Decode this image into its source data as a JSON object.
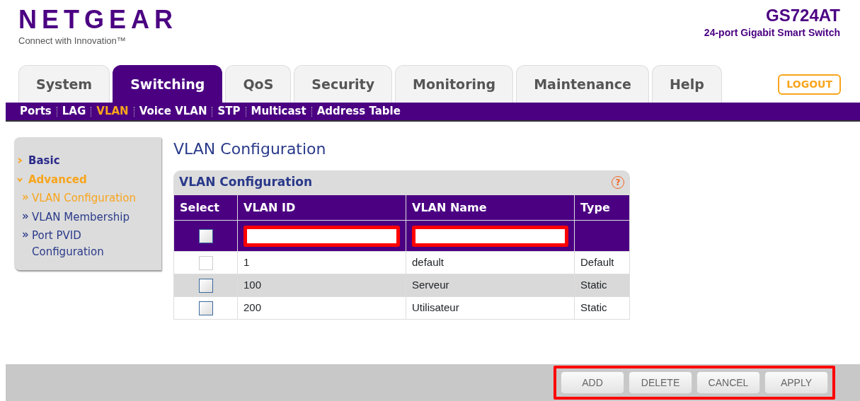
{
  "header": {
    "brand": "NETGEAR",
    "tagline": "Connect with Innovation™",
    "model": "GS724AT",
    "model_description": "24-port Gigabit Smart Switch"
  },
  "tabs": [
    {
      "label": "System",
      "selected": false
    },
    {
      "label": "Switching",
      "selected": true
    },
    {
      "label": "QoS",
      "selected": false
    },
    {
      "label": "Security",
      "selected": false
    },
    {
      "label": "Monitoring",
      "selected": false
    },
    {
      "label": "Maintenance",
      "selected": false
    },
    {
      "label": "Help",
      "selected": false
    }
  ],
  "logout": "LOGOUT",
  "subnav": [
    {
      "label": "Ports",
      "selected": false
    },
    {
      "label": "LAG",
      "selected": false
    },
    {
      "label": "VLAN",
      "selected": true
    },
    {
      "label": "Voice VLAN",
      "selected": false
    },
    {
      "label": "STP",
      "selected": false
    },
    {
      "label": "Multicast",
      "selected": false
    },
    {
      "label": "Address Table",
      "selected": false
    }
  ],
  "sidebar": {
    "items": [
      {
        "label": "Basic",
        "selected": false,
        "expanded": false
      },
      {
        "label": "Advanced",
        "selected": true,
        "expanded": true,
        "children": [
          {
            "label": "VLAN Configuration",
            "selected": true
          },
          {
            "label": "VLAN Membership",
            "selected": false
          },
          {
            "label": "Port PVID Configuration",
            "selected": false
          }
        ]
      }
    ]
  },
  "page_title": "VLAN Configuration",
  "panel": {
    "title": "VLAN Configuration",
    "help": "?",
    "table": {
      "columns": [
        "Select",
        "VLAN ID",
        "VLAN Name",
        "Type"
      ],
      "new_row": {
        "checked": false,
        "highlighted": true
      },
      "rows": [
        {
          "checked": false,
          "disabled": true,
          "vlan_id": "1",
          "vlan_name": "default",
          "type": "Default"
        },
        {
          "checked": false,
          "disabled": false,
          "vlan_id": "100",
          "vlan_name": "Serveur",
          "type": "Static"
        },
        {
          "checked": false,
          "disabled": false,
          "vlan_id": "200",
          "vlan_name": "Utilisateur",
          "type": "Static"
        }
      ]
    }
  },
  "buttons": {
    "highlighted": true,
    "items": [
      "ADD",
      "DELETE",
      "CANCEL",
      "APPLY"
    ]
  }
}
